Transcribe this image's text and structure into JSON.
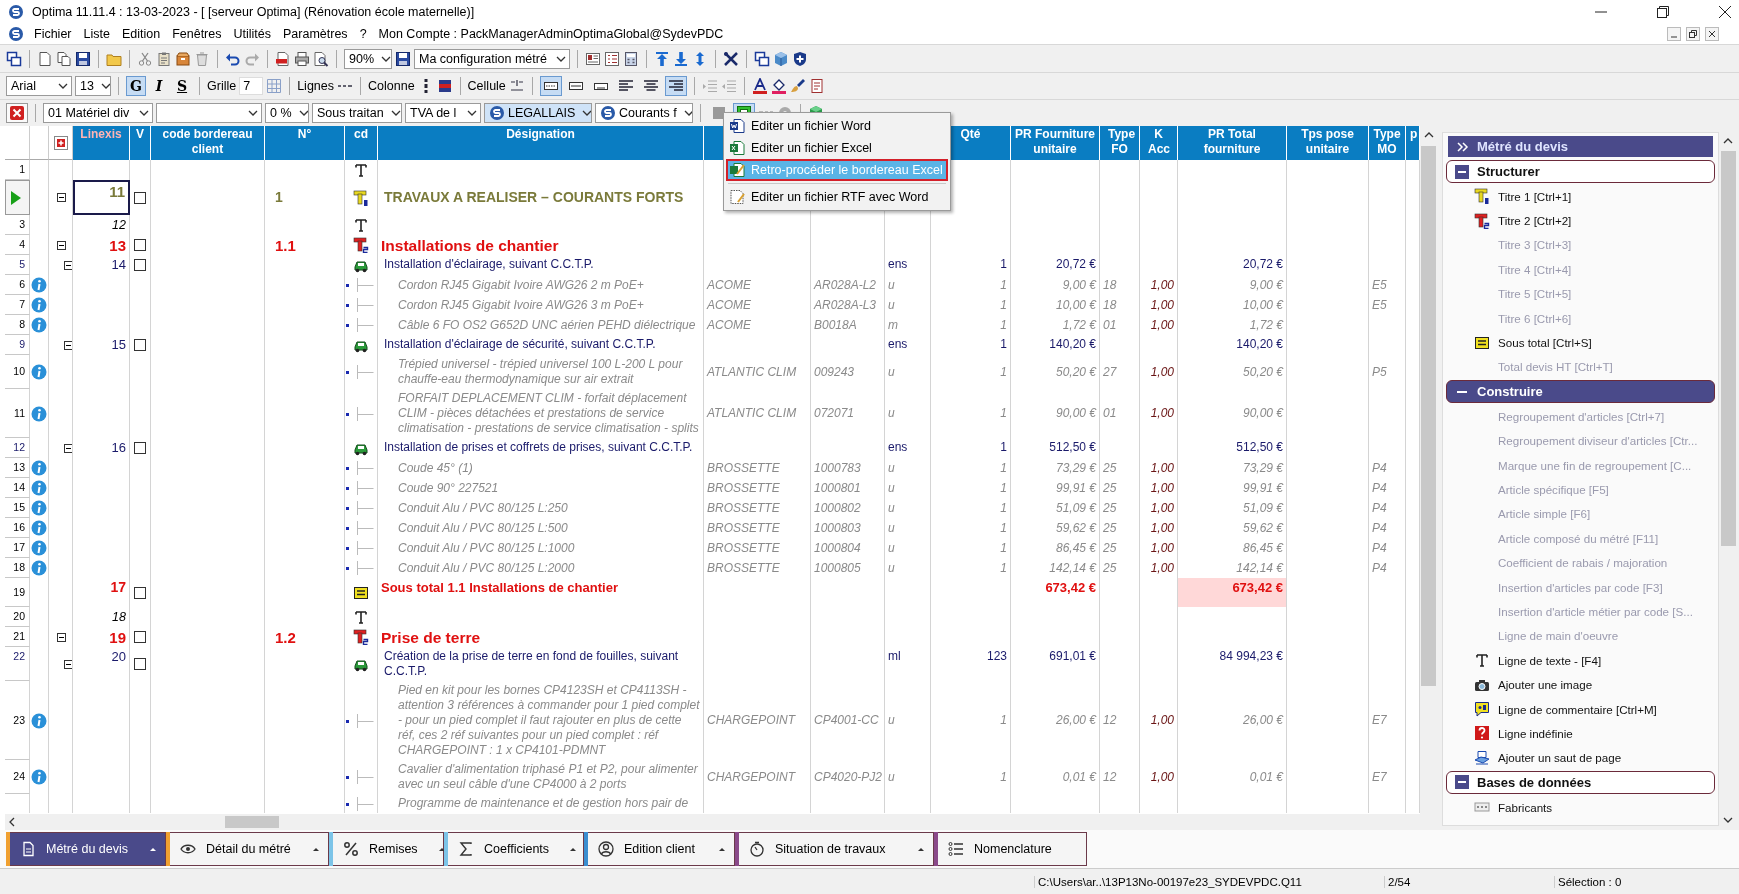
{
  "window": {
    "title": "Optima 11.11.4 : 13-03-2023 - [ [serveur Optima] (Rénovation école maternelle)]"
  },
  "menu_bar": {
    "items": [
      "Fichier",
      "Liste",
      "Edition",
      "Fenêtres",
      "Utilités",
      "Paramètres",
      "?"
    ],
    "account": "Mon Compte : PackManagerAdminOptimaGlobal@SydevPDC"
  },
  "toolbar_1": {
    "zoom": "90%",
    "configuration": "Ma configuration métré"
  },
  "toolbar_2": {
    "font": "Arial",
    "font_size": "13",
    "style_buttons": [
      {
        "label": "G",
        "pressed": true
      },
      {
        "label": "I",
        "pressed": false
      },
      {
        "label": "S",
        "pressed": false
      }
    ],
    "grid_label": "Grille",
    "grid_value": "7",
    "lines_label": "Lignes",
    "column_label": "Colonne",
    "cell_label": "Cellule",
    "border_buttons": [
      {
        "pressed": true
      },
      {
        "pressed": false
      },
      {
        "pressed": false
      }
    ],
    "align_buttons": [
      {
        "pressed": false
      },
      {
        "pressed": false
      },
      {
        "pressed": true
      }
    ]
  },
  "toolbar_3": {
    "filters": [
      {
        "kind": "combo",
        "value": "01 Matériel div",
        "highlighted": false
      },
      {
        "kind": "combo",
        "highlighted": false
      },
      {
        "kind": "combo",
        "value": "0 %",
        "highlighted": false
      },
      {
        "kind": "combo",
        "value": "Sous traitan",
        "highlighted": false
      },
      {
        "kind": "combo",
        "value": "TVA de l",
        "highlighted": false
      },
      {
        "kind": "logo_combo",
        "value": "LEGALLAIS",
        "highlighted": true
      },
      {
        "kind": "logo_combo",
        "value": "Courants f",
        "highlighted": false
      }
    ],
    "tools": [
      {
        "pressed": false
      },
      {
        "pressed": true
      }
    ]
  },
  "export_menu": {
    "items": [
      {
        "kind": "item",
        "label": "Editer un fichier Word",
        "selected": false
      },
      {
        "kind": "item",
        "label": "Editer un fichier Excel",
        "selected": false
      },
      {
        "kind": "item",
        "label": "Retro-procéder le bordereau Excel",
        "selected": true
      },
      {
        "kind": "separator"
      },
      {
        "kind": "item",
        "label": "Editer un fichier RTF avec Word",
        "selected": false
      }
    ]
  },
  "table": {
    "columns": [
      "Linexis",
      "V",
      "code bordereau client",
      "N°",
      "cd",
      "Désignation",
      "Qté",
      "PR Fourniture unitaire",
      "Type FO",
      "K Acc",
      "PR Total fourniture",
      "Tps pose unitaire",
      "Type MO",
      "p"
    ],
    "rows": [
      {
        "kind": "text",
        "row": "1",
        "selected": false
      },
      {
        "kind": "title1",
        "linexis": "11",
        "expanded": true,
        "checked": false,
        "number": "1",
        "designation": "TRAVAUX A REALISER – COURANTS FORTS",
        "selected": true
      },
      {
        "kind": "text",
        "row": "3",
        "linexis": "12",
        "selected": false
      },
      {
        "kind": "title2",
        "row": "4",
        "linexis": "13",
        "expanded": true,
        "checked": false,
        "number": "1.1",
        "designation": "Installations de chantier",
        "selected": false
      },
      {
        "kind": "article",
        "row": "5",
        "linexis": "14",
        "expanded": true,
        "checked": false,
        "designation": "Installation d'éclairage, suivant C.C.T.P.",
        "unit": "ens",
        "qty": "1",
        "unit_price": "20,72 €",
        "total": "20,72 €",
        "selected": false
      },
      {
        "kind": "component",
        "row": "6",
        "info": true,
        "designation": "Cordon RJ45 Gigabit Ivoire AWG26 2 m PoE+",
        "supplier": "ACOME",
        "ref": "AR028A-L2",
        "unit": "u",
        "qty": "1",
        "unit_price": "9,00 €",
        "type_fo": "18",
        "k_acc": "1,00",
        "total": "9,00 €",
        "type_mo": "E5",
        "selected": false
      },
      {
        "kind": "component",
        "row": "7",
        "info": true,
        "designation": "Cordon RJ45 Gigabit Ivoire AWG26 3 m PoE+",
        "supplier": "ACOME",
        "ref": "AR028A-L3",
        "unit": "u",
        "qty": "1",
        "unit_price": "10,00 €",
        "type_fo": "18",
        "k_acc": "1,00",
        "total": "10,00 €",
        "type_mo": "E5",
        "selected": false
      },
      {
        "kind": "component",
        "row": "8",
        "info": true,
        "designation": "Câble 6 FO OS2 G652D UNC aérien PEHD diélectrique",
        "supplier": "ACOME",
        "ref": "B0018A",
        "unit": "m",
        "qty": "1",
        "unit_price": "1,72 €",
        "type_fo": "01",
        "k_acc": "1,00",
        "total": "1,72 €",
        "selected": false
      },
      {
        "kind": "article",
        "row": "9",
        "linexis": "15",
        "expanded": true,
        "checked": false,
        "designation": "Installation d'éclairage de sécurité, suivant C.C.T.P.",
        "unit": "ens",
        "qty": "1",
        "unit_price": "140,20 €",
        "total": "140,20 €",
        "selected": false
      },
      {
        "kind": "component",
        "row": "10",
        "info": true,
        "designation": "Trépied universel - trépied universel 100 L-200 L pour chauffe-eau thermodynamique sur air extrait",
        "supplier": "ATLANTIC CLIM",
        "ref": "009243",
        "unit": "u",
        "qty": "1",
        "unit_price": "50,20 €",
        "type_fo": "27",
        "k_acc": "1,00",
        "total": "50,20 €",
        "type_mo": "P5",
        "selected": false
      },
      {
        "kind": "component",
        "row": "11",
        "info": true,
        "designation": "FORFAIT DEPLACEMENT CLIM - forfait déplacement CLIM - pièces détachées et prestations de service climatisation - prestations de service climatisation - splits",
        "supplier": "ATLANTIC CLIM",
        "ref": "072071",
        "unit": "u",
        "qty": "1",
        "unit_price": "90,00 €",
        "type_fo": "01",
        "k_acc": "1,00",
        "total": "90,00 €",
        "selected": false
      },
      {
        "kind": "article",
        "row": "12",
        "linexis": "16",
        "expanded": true,
        "checked": false,
        "designation": "Installation de prises et coffrets de prises, suivant C.C.T.P.",
        "unit": "ens",
        "qty": "1",
        "unit_price": "512,50 €",
        "total": "512,50 €",
        "selected": false
      },
      {
        "kind": "component",
        "row": "13",
        "info": true,
        "designation": "Coude 45° (1)",
        "supplier": "BROSSETTE",
        "ref": "1000783",
        "unit": "u",
        "qty": "1",
        "unit_price": "73,29 €",
        "type_fo": "25",
        "k_acc": "1,00",
        "total": "73,29 €",
        "type_mo": "P4",
        "selected": false
      },
      {
        "kind": "component",
        "row": "14",
        "info": true,
        "designation": "Coude 90° 227521",
        "supplier": "BROSSETTE",
        "ref": "1000801",
        "unit": "u",
        "qty": "1",
        "unit_price": "99,91 €",
        "type_fo": "25",
        "k_acc": "1,00",
        "total": "99,91 €",
        "type_mo": "P4",
        "selected": false
      },
      {
        "kind": "component",
        "row": "15",
        "info": true,
        "designation": "Conduit Alu / PVC 80/125 L:250",
        "supplier": "BROSSETTE",
        "ref": "1000802",
        "unit": "u",
        "qty": "1",
        "unit_price": "51,09 €",
        "type_fo": "25",
        "k_acc": "1,00",
        "total": "51,09 €",
        "type_mo": "P4",
        "selected": false
      },
      {
        "kind": "component",
        "row": "16",
        "info": true,
        "designation": "Conduit Alu / PVC 80/125 L:500",
        "supplier": "BROSSETTE",
        "ref": "1000803",
        "unit": "u",
        "qty": "1",
        "unit_price": "59,62 €",
        "type_fo": "25",
        "k_acc": "1,00",
        "total": "59,62 €",
        "type_mo": "P4",
        "selected": false
      },
      {
        "kind": "component",
        "row": "17",
        "info": true,
        "designation": "Conduit Alu / PVC 80/125 L:1000",
        "supplier": "BROSSETTE",
        "ref": "1000804",
        "unit": "u",
        "qty": "1",
        "unit_price": "86,45 €",
        "type_fo": "25",
        "k_acc": "1,00",
        "total": "86,45 €",
        "type_mo": "P4",
        "selected": false
      },
      {
        "kind": "component",
        "row": "18",
        "info": true,
        "designation": "Conduit Alu / PVC 80/125 L:2000",
        "supplier": "BROSSETTE",
        "ref": "1000805",
        "unit": "u",
        "qty": "1",
        "unit_price": "142,14 €",
        "type_fo": "25",
        "k_acc": "1,00",
        "total": "142,14 €",
        "type_mo": "P4",
        "selected": false
      },
      {
        "kind": "subtotal",
        "row": "19",
        "linexis": "17",
        "checked": false,
        "designation": "Sous total 1.1 Installations de chantier",
        "unit_price": "673,42 €",
        "total": "673,42 €",
        "selected": false
      },
      {
        "kind": "text",
        "row": "20",
        "linexis": "18",
        "selected": false
      },
      {
        "kind": "title2",
        "row": "21",
        "linexis": "19",
        "expanded": true,
        "checked": false,
        "number": "1.2",
        "designation": "Prise de terre",
        "selected": false
      },
      {
        "kind": "article",
        "row": "22",
        "linexis": "20",
        "expanded": true,
        "checked": false,
        "designation": "Création de la prise de terre en fond de fouilles, suivant C.C.T.P.",
        "unit": "ml",
        "qty": "123",
        "unit_price": "691,01 €",
        "total": "84 994,23 €",
        "selected": false
      },
      {
        "kind": "component",
        "row": "23",
        "info": true,
        "designation": "Pied en kit pour les bornes CP4123SH et CP4113SH - attention 3 références à commander pour 1 pied complet - pour un pied complet il faut rajouter en plus de cette réf, ces 2 réf suivantes pour un pied complet : réf CHARGEPOINT : 1 x CP4101-PDMNT",
        "supplier": "CHARGEPOINT",
        "ref": "CP4001-CC",
        "unit": "u",
        "qty": "1",
        "unit_price": "26,00 €",
        "type_fo": "12",
        "k_acc": "1,00",
        "total": "26,00 €",
        "type_mo": "E7",
        "selected": false
      },
      {
        "kind": "component",
        "row": "24",
        "info": true,
        "designation": "Cavalier d'alimentation triphasé P1 et P2, pour alimenter avec un seul câble d'une CP4000 à 2 ports",
        "supplier": "CHARGEPOINT",
        "ref": "CP4020-PJ2",
        "unit": "u",
        "qty": "1",
        "unit_price": "0,01 €",
        "type_fo": "12",
        "k_acc": "1,00",
        "total": "0,01 €",
        "type_mo": "E7",
        "selected": false
      },
      {
        "kind": "component",
        "info": false,
        "designation": "Programme de maintenance et de gestion hors pair de",
        "selected": false
      }
    ]
  },
  "side_panel": {
    "title": "Métré du devis",
    "groups": [
      {
        "label": "Structurer",
        "selected": false,
        "expanded": true,
        "items": [
          {
            "kind": "title1",
            "label": "Titre 1 [Ctrl+1]",
            "disabled": false
          },
          {
            "kind": "title2",
            "label": "Titre 2 [Ctrl+2]",
            "disabled": false
          },
          {
            "kind": "command",
            "label": "Titre 3 [Ctrl+3]",
            "disabled": true
          },
          {
            "kind": "command",
            "label": "Titre 4 [Ctrl+4]",
            "disabled": true
          },
          {
            "kind": "command",
            "label": "Titre 5 [Ctrl+5]",
            "disabled": true
          },
          {
            "kind": "command",
            "label": "Titre 6 [Ctrl+6]",
            "disabled": true
          },
          {
            "kind": "subtotal",
            "label": "Sous total [Ctrl+S]",
            "disabled": false
          },
          {
            "kind": "command",
            "label": "Total devis HT [Ctrl+T]",
            "disabled": true
          }
        ]
      },
      {
        "label": "Construire",
        "selected": true,
        "expanded": true,
        "items": [
          {
            "kind": "command",
            "label": "Regroupement d'articles [Ctrl+7]",
            "disabled": true
          },
          {
            "kind": "command",
            "label": "Regroupement diviseur d'articles [Ctr...",
            "disabled": true
          },
          {
            "kind": "command",
            "label": "Marque une fin de regroupement [C...",
            "disabled": true
          },
          {
            "kind": "command",
            "label": "Article spécifique [F5]",
            "disabled": true
          },
          {
            "kind": "command",
            "label": "Article simple [F6]",
            "disabled": true
          },
          {
            "kind": "command",
            "label": "Article composé du métré [F11]",
            "disabled": true
          },
          {
            "kind": "command",
            "label": "Coefficient de rabais / majoration",
            "disabled": true
          },
          {
            "kind": "command",
            "label": "Insertion d'articles par code [F3]",
            "disabled": true
          },
          {
            "kind": "command",
            "label": "Insertion d'article métier par code [S...",
            "disabled": true
          },
          {
            "kind": "command",
            "label": "Ligne de main d'oeuvre",
            "disabled": true
          },
          {
            "kind": "text",
            "label": "Ligne de texte - [F4]",
            "disabled": false
          },
          {
            "kind": "image",
            "label": "Ajouter une image",
            "disabled": false
          },
          {
            "kind": "comment",
            "label": "Ligne de commentaire [Ctrl+M]",
            "disabled": false
          },
          {
            "kind": "undefined",
            "label": "Ligne indéfinie",
            "disabled": false
          },
          {
            "kind": "page_break",
            "label": "Ajouter un saut de page",
            "disabled": false
          }
        ]
      },
      {
        "label": "Bases de données",
        "selected": false,
        "expanded": true,
        "items": [
          {
            "kind": "manufacturer",
            "label": "Fabricants",
            "disabled": false
          }
        ]
      }
    ]
  },
  "bottom_tabs": [
    {
      "label": "Métré du devis",
      "selected": true,
      "color": "#f0a030",
      "dropdown": true
    },
    {
      "label": "Détail du métré",
      "selected": false,
      "color": "#f0a030",
      "dropdown": true
    },
    {
      "label": "Remises",
      "selected": false,
      "color": "#7cc4e8",
      "dropdown": true
    },
    {
      "label": "Coefficients",
      "selected": false,
      "color": "#7cc4e8",
      "dropdown": true
    },
    {
      "label": "Edition client",
      "selected": false,
      "color": "#3a8ed0",
      "dropdown": true
    },
    {
      "label": "Situation de travaux",
      "selected": false,
      "color": "#8a4a8a",
      "dropdown": true
    },
    {
      "label": "Nomenclature",
      "selected": false,
      "color": "#8a4a8a",
      "dropdown": false
    }
  ],
  "status_bar": {
    "path": "C:\\Users\\ar..\\13P13No-00197e23_SYDEVPDC.Q11",
    "page": "2/54",
    "selection": "Sélection : 0"
  }
}
